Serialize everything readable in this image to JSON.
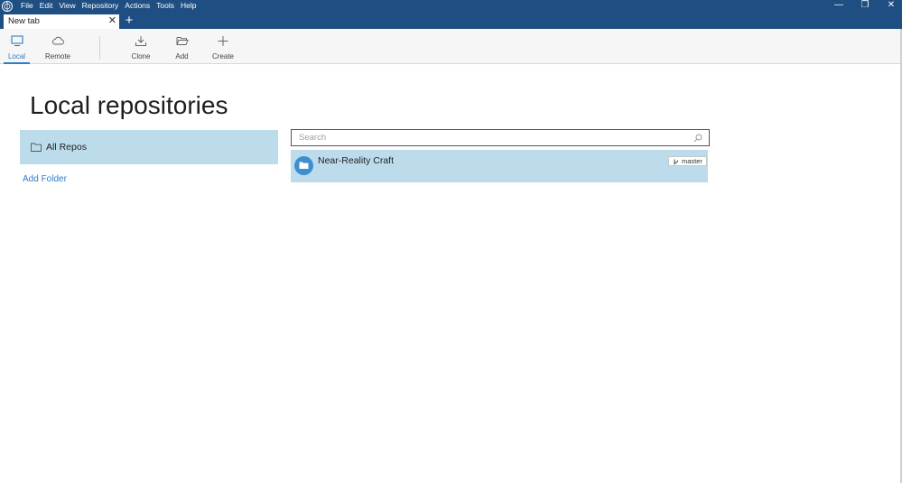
{
  "titlebar": {
    "menu": [
      "File",
      "Edit",
      "View",
      "Repository",
      "Actions",
      "Tools",
      "Help"
    ],
    "minimize": "—",
    "restore": "❐",
    "close": "✕"
  },
  "tabs": [
    {
      "label": "New tab",
      "close": "✕"
    }
  ],
  "new_tab": "+",
  "toolbar": {
    "local": "Local",
    "remote": "Remote",
    "clone": "Clone",
    "add": "Add",
    "create": "Create"
  },
  "main": {
    "title": "Local repositories",
    "all_repos": "All Repos",
    "add_folder": "Add Folder",
    "search_placeholder": "Search",
    "repos": [
      {
        "name": "Near-Reality Craft",
        "branch": "master"
      }
    ]
  },
  "colors": {
    "titlebar": "#1f4e83",
    "accent": "#2e7bc6",
    "selection": "#bcdcec",
    "avatar": "#3e8fd0"
  }
}
